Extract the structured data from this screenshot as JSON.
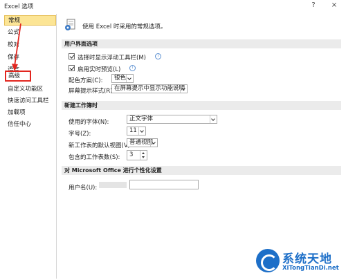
{
  "window": {
    "title": "Excel 选项",
    "help_label": "?",
    "close_label": "×"
  },
  "sidebar": {
    "items": [
      {
        "label": "常规"
      },
      {
        "label": "公式"
      },
      {
        "label": "校对"
      },
      {
        "label": "保存"
      },
      {
        "label": "语言"
      },
      {
        "label": "高级"
      },
      {
        "label": "自定义功能区"
      },
      {
        "label": "快速访问工具栏"
      },
      {
        "label": "加载项"
      },
      {
        "label": "信任中心"
      }
    ],
    "selected_index": 0,
    "highlighted_index": 5
  },
  "main": {
    "header": "使用 Excel 时采用的常规选项。",
    "ui_section": {
      "title": "用户界面选项",
      "mini_toolbar_label": "选择时显示浮动工具栏(M)",
      "live_preview_label": "启用实时预览(L)",
      "color_scheme_label": "配色方案(C):",
      "color_scheme_value": "银色",
      "screentip_label": "屏幕提示样式(R):",
      "screentip_value": "在屏幕提示中显示功能说明"
    },
    "workbook_section": {
      "title": "新建工作簿时",
      "font_label": "使用的字体(N):",
      "font_value": "正文字体",
      "size_label": "字号(Z):",
      "size_value": "11",
      "view_label": "新工作表的默认视图(V):",
      "view_value": "普通视图",
      "sheets_label": "包含的工作表数(S):",
      "sheets_value": "3"
    },
    "personalize_section": {
      "title": "对 Microsoft Office 进行个性化设置",
      "username_label": "用户名(U):"
    }
  },
  "watermark": {
    "title": "系统天地",
    "url": "XiTongTianDi.net"
  },
  "colors": {
    "selected_bg": "#fce595",
    "highlight_border": "#e2261f",
    "section_bg": "#ebebeb",
    "watermark_blue": "#1d6fc8"
  }
}
